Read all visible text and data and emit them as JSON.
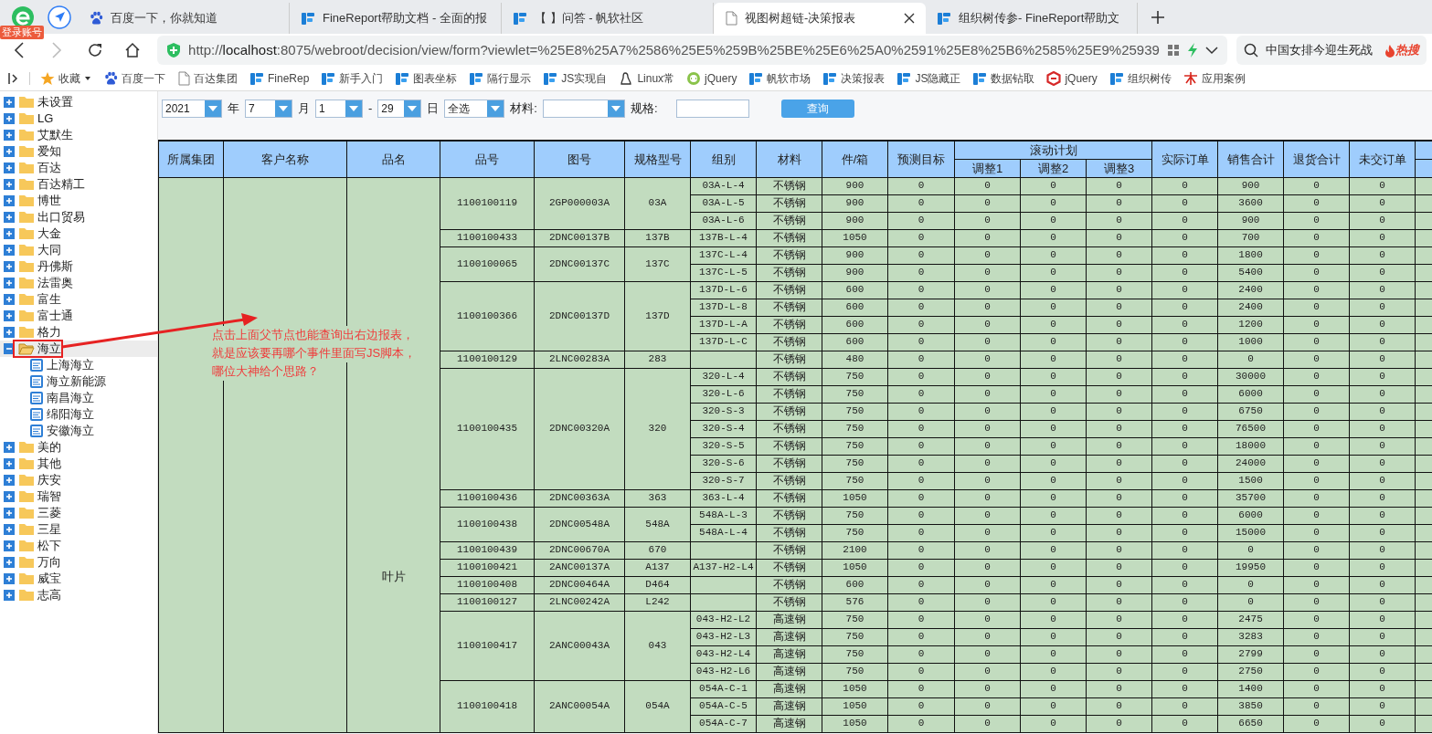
{
  "browser": {
    "login_badge": "登录账号",
    "tabs": [
      {
        "title": "百度一下，你就知道",
        "kind": "paw",
        "selected": false
      },
      {
        "title": "FineReport帮助文档 - 全面的报",
        "kind": "brand",
        "selected": false
      },
      {
        "title": "【        】问答 - 帆软社区",
        "kind": "brand",
        "selected": false
      },
      {
        "title": "视图树超链-决策报表",
        "kind": "page",
        "selected": true
      },
      {
        "title": "组织树传参- FineReport帮助文",
        "kind": "brand",
        "selected": false
      }
    ],
    "address": "http://**localhost**:8075/webroot/decision/view/form?viewlet=%25E8%25A7%2586%25E5%259B%25BE%25E6%25A0%2591%25E8%25B6%2585%25E9%25939",
    "search": {
      "text": "中国女排今迎生死战",
      "hot": "热搜"
    },
    "bookmarks": [
      {
        "title": "收藏",
        "kind": "star"
      },
      {
        "title": "百度一下",
        "kind": "paw"
      },
      {
        "title": "百达集团",
        "kind": "page"
      },
      {
        "title": "FineRep",
        "kind": "brand"
      },
      {
        "title": "新手入门",
        "kind": "brand"
      },
      {
        "title": "图表坐标",
        "kind": "brand"
      },
      {
        "title": "隔行显示",
        "kind": "brand"
      },
      {
        "title": "JS实现自",
        "kind": "brand"
      },
      {
        "title": "Linux常",
        "kind": "linux"
      },
      {
        "title": "jQuery",
        "kind": "jq"
      },
      {
        "title": "帆软市场",
        "kind": "brand"
      },
      {
        "title": "决策报表",
        "kind": "brand"
      },
      {
        "title": "JS隐藏正",
        "kind": "brand"
      },
      {
        "title": "数据钻取",
        "kind": "brand"
      },
      {
        "title": "jQuery",
        "kind": "jqred"
      },
      {
        "title": "组织树传",
        "kind": "brand"
      },
      {
        "title": "应用案例",
        "kind": "case"
      }
    ]
  },
  "tree": [
    {
      "label": "未设置",
      "kind": "folder",
      "expanded": false,
      "selected": false
    },
    {
      "label": "LG",
      "kind": "folder",
      "expanded": false,
      "selected": false
    },
    {
      "label": "艾默生",
      "kind": "folder",
      "expanded": false,
      "selected": false
    },
    {
      "label": "爱知",
      "kind": "folder",
      "expanded": false,
      "selected": false
    },
    {
      "label": "百达",
      "kind": "folder",
      "expanded": false,
      "selected": false
    },
    {
      "label": "百达精工",
      "kind": "folder",
      "expanded": false,
      "selected": false
    },
    {
      "label": "博世",
      "kind": "folder",
      "expanded": false,
      "selected": false
    },
    {
      "label": "出口贸易",
      "kind": "folder",
      "expanded": false,
      "selected": false
    },
    {
      "label": "大金",
      "kind": "folder",
      "expanded": false,
      "selected": false
    },
    {
      "label": "大同",
      "kind": "folder",
      "expanded": false,
      "selected": false
    },
    {
      "label": "丹佛斯",
      "kind": "folder",
      "expanded": false,
      "selected": false
    },
    {
      "label": "法雷奥",
      "kind": "folder",
      "expanded": false,
      "selected": false
    },
    {
      "label": "富生",
      "kind": "folder",
      "expanded": false,
      "selected": false
    },
    {
      "label": "富士通",
      "kind": "folder",
      "expanded": false,
      "selected": false
    },
    {
      "label": "格力",
      "kind": "folder",
      "expanded": false,
      "selected": false
    },
    {
      "label": "海立",
      "kind": "folder",
      "expanded": true,
      "selected": true,
      "children": [
        {
          "label": "上海海立",
          "kind": "report",
          "selected": false
        },
        {
          "label": "海立新能源",
          "kind": "report",
          "selected": false
        },
        {
          "label": "南昌海立",
          "kind": "report",
          "selected": false
        },
        {
          "label": "绵阳海立",
          "kind": "report",
          "selected": false
        },
        {
          "label": "安徽海立",
          "kind": "report",
          "selected": false
        }
      ]
    },
    {
      "label": "美的",
      "kind": "folder",
      "expanded": false,
      "selected": false
    },
    {
      "label": "其他",
      "kind": "folder",
      "expanded": false,
      "selected": false
    },
    {
      "label": "庆安",
      "kind": "folder",
      "expanded": false,
      "selected": false
    },
    {
      "label": "瑞智",
      "kind": "folder",
      "expanded": false,
      "selected": false
    },
    {
      "label": "三菱",
      "kind": "folder",
      "expanded": false,
      "selected": false
    },
    {
      "label": "三星",
      "kind": "folder",
      "expanded": false,
      "selected": false
    },
    {
      "label": "松下",
      "kind": "folder",
      "expanded": false,
      "selected": false
    },
    {
      "label": "万向",
      "kind": "folder",
      "expanded": false,
      "selected": false
    },
    {
      "label": "威宝",
      "kind": "folder",
      "expanded": false,
      "selected": false
    },
    {
      "label": "志高",
      "kind": "folder",
      "expanded": false,
      "selected": false
    }
  ],
  "filters": [
    {
      "kind": "combo",
      "value": "2021"
    },
    {
      "kind": "label",
      "text": "年"
    },
    {
      "kind": "combo",
      "value": "7"
    },
    {
      "kind": "label",
      "text": "月"
    },
    {
      "kind": "combo",
      "value": "1"
    },
    {
      "kind": "label",
      "text": "-"
    },
    {
      "kind": "combo",
      "value": "29"
    },
    {
      "kind": "label",
      "text": "日"
    },
    {
      "kind": "combo",
      "value": "全选"
    },
    {
      "kind": "label",
      "text": "材料:"
    },
    {
      "kind": "combo"
    },
    {
      "kind": "label",
      "text": "规格:"
    },
    {
      "kind": "input"
    },
    {
      "kind": "button",
      "text": "查询"
    }
  ],
  "annotation": {
    "lines": [
      "点击上面父节点也能查询出右边报表，",
      "就是应该要再哪个事件里面写JS脚本，",
      "哪位大神给个思路？"
    ]
  },
  "table": {
    "columns": [
      {
        "label": "所属集团"
      },
      {
        "label": "客户名称"
      },
      {
        "label": "品名"
      },
      {
        "label": "品号"
      },
      {
        "label": "图号"
      },
      {
        "label": "规格型号"
      },
      {
        "label": "组别"
      },
      {
        "label": "材料"
      },
      {
        "label": "件/箱"
      },
      {
        "label": "预测目标"
      },
      {
        "label": "滚动计划",
        "children": [
          "调整1",
          "调整2",
          "调整3"
        ]
      },
      {
        "label": "实际订单"
      },
      {
        "label": "销售合计"
      },
      {
        "label": "退货合计"
      },
      {
        "label": "未交订单"
      }
    ],
    "product_name": "叶片",
    "products": [
      {
        "part_no": "1100100119",
        "drawing_no": "2GP000003A",
        "spec": "03A",
        "items": [
          {
            "group": "03A-L-4",
            "material": "不锈钢",
            "per_box": "900",
            "values": [
              "0",
              "0",
              "0",
              "0",
              "0",
              "900",
              "0",
              "0"
            ]
          },
          {
            "group": "03A-L-5",
            "material": "不锈钢",
            "per_box": "900",
            "values": [
              "0",
              "0",
              "0",
              "0",
              "0",
              "3600",
              "0",
              "0"
            ]
          },
          {
            "group": "03A-L-6",
            "material": "不锈钢",
            "per_box": "900",
            "values": [
              "0",
              "0",
              "0",
              "0",
              "0",
              "900",
              "0",
              "0"
            ]
          }
        ]
      },
      {
        "part_no": "1100100433",
        "drawing_no": "2DNC00137B",
        "spec": "137B",
        "items": [
          {
            "group": "137B-L-4",
            "material": "不锈钢",
            "per_box": "1050",
            "values": [
              "0",
              "0",
              "0",
              "0",
              "0",
              "700",
              "0",
              "0"
            ]
          }
        ]
      },
      {
        "part_no": "1100100065",
        "drawing_no": "2DNC00137C",
        "spec": "137C",
        "items": [
          {
            "group": "137C-L-4",
            "material": "不锈钢",
            "per_box": "900",
            "values": [
              "0",
              "0",
              "0",
              "0",
              "0",
              "1800",
              "0",
              "0"
            ]
          },
          {
            "group": "137C-L-5",
            "material": "不锈钢",
            "per_box": "900",
            "values": [
              "0",
              "0",
              "0",
              "0",
              "0",
              "5400",
              "0",
              "0"
            ]
          }
        ]
      },
      {
        "part_no": "1100100366",
        "drawing_no": "2DNC00137D",
        "spec": "137D",
        "items": [
          {
            "group": "137D-L-6",
            "material": "不锈钢",
            "per_box": "600",
            "values": [
              "0",
              "0",
              "0",
              "0",
              "0",
              "2400",
              "0",
              "0"
            ]
          },
          {
            "group": "137D-L-8",
            "material": "不锈钢",
            "per_box": "600",
            "values": [
              "0",
              "0",
              "0",
              "0",
              "0",
              "2400",
              "0",
              "0"
            ]
          },
          {
            "group": "137D-L-A",
            "material": "不锈钢",
            "per_box": "600",
            "values": [
              "0",
              "0",
              "0",
              "0",
              "0",
              "1200",
              "0",
              "0"
            ]
          },
          {
            "group": "137D-L-C",
            "material": "不锈钢",
            "per_box": "600",
            "values": [
              "0",
              "0",
              "0",
              "0",
              "0",
              "1000",
              "0",
              "0"
            ]
          }
        ]
      },
      {
        "part_no": "1100100129",
        "drawing_no": "2LNC00283A",
        "spec": "283",
        "items": [
          {
            "material": "不锈钢",
            "per_box": "480",
            "values": [
              "0",
              "0",
              "0",
              "0",
              "0",
              "0",
              "0",
              "0"
            ]
          }
        ]
      },
      {
        "part_no": "1100100435",
        "drawing_no": "2DNC00320A",
        "spec": "320",
        "items": [
          {
            "group": "320-L-4",
            "material": "不锈钢",
            "per_box": "750",
            "values": [
              "0",
              "0",
              "0",
              "0",
              "0",
              "30000",
              "0",
              "0"
            ]
          },
          {
            "group": "320-L-6",
            "material": "不锈钢",
            "per_box": "750",
            "values": [
              "0",
              "0",
              "0",
              "0",
              "0",
              "6000",
              "0",
              "0"
            ]
          },
          {
            "group": "320-S-3",
            "material": "不锈钢",
            "per_box": "750",
            "values": [
              "0",
              "0",
              "0",
              "0",
              "0",
              "6750",
              "0",
              "0"
            ]
          },
          {
            "group": "320-S-4",
            "material": "不锈钢",
            "per_box": "750",
            "values": [
              "0",
              "0",
              "0",
              "0",
              "0",
              "76500",
              "0",
              "0"
            ]
          },
          {
            "group": "320-S-5",
            "material": "不锈钢",
            "per_box": "750",
            "values": [
              "0",
              "0",
              "0",
              "0",
              "0",
              "18000",
              "0",
              "0"
            ]
          },
          {
            "group": "320-S-6",
            "material": "不锈钢",
            "per_box": "750",
            "values": [
              "0",
              "0",
              "0",
              "0",
              "0",
              "24000",
              "0",
              "0"
            ]
          },
          {
            "group": "320-S-7",
            "material": "不锈钢",
            "per_box": "750",
            "values": [
              "0",
              "0",
              "0",
              "0",
              "0",
              "1500",
              "0",
              "0"
            ]
          }
        ]
      },
      {
        "part_no": "1100100436",
        "drawing_no": "2DNC00363A",
        "spec": "363",
        "items": [
          {
            "group": "363-L-4",
            "material": "不锈钢",
            "per_box": "1050",
            "values": [
              "0",
              "0",
              "0",
              "0",
              "0",
              "35700",
              "0",
              "0"
            ]
          }
        ]
      },
      {
        "part_no": "1100100438",
        "drawing_no": "2DNC00548A",
        "spec": "548A",
        "items": [
          {
            "group": "548A-L-3",
            "material": "不锈钢",
            "per_box": "750",
            "values": [
              "0",
              "0",
              "0",
              "0",
              "0",
              "6000",
              "0",
              "0"
            ]
          },
          {
            "group": "548A-L-4",
            "material": "不锈钢",
            "per_box": "750",
            "values": [
              "0",
              "0",
              "0",
              "0",
              "0",
              "15000",
              "0",
              "0"
            ]
          }
        ]
      },
      {
        "part_no": "1100100439",
        "drawing_no": "2DNC00670A",
        "spec": "670",
        "items": [
          {
            "material": "不锈钢",
            "per_box": "2100",
            "values": [
              "0",
              "0",
              "0",
              "0",
              "0",
              "0",
              "0",
              "0"
            ]
          }
        ]
      },
      {
        "part_no": "1100100421",
        "drawing_no": "2ANC00137A",
        "spec": "A137",
        "items": [
          {
            "group": "A137-H2-L4",
            "material": "不锈钢",
            "per_box": "1050",
            "values": [
              "0",
              "0",
              "0",
              "0",
              "0",
              "19950",
              "0",
              "0"
            ]
          }
        ]
      },
      {
        "part_no": "1100100408",
        "drawing_no": "2DNC00464A",
        "spec": "D464",
        "items": [
          {
            "material": "不锈钢",
            "per_box": "600",
            "values": [
              "0",
              "0",
              "0",
              "0",
              "0",
              "0",
              "0",
              "0"
            ]
          }
        ]
      },
      {
        "part_no": "1100100127",
        "drawing_no": "2LNC00242A",
        "spec": "L242",
        "items": [
          {
            "material": "不锈钢",
            "per_box": "576",
            "values": [
              "0",
              "0",
              "0",
              "0",
              "0",
              "0",
              "0",
              "0"
            ]
          }
        ]
      },
      {
        "part_no": "1100100417",
        "drawing_no": "2ANC00043A",
        "spec": "043",
        "items": [
          {
            "group": "043-H2-L2",
            "material": "高速钢",
            "per_box": "750",
            "values": [
              "0",
              "0",
              "0",
              "0",
              "0",
              "2475",
              "0",
              "0"
            ]
          },
          {
            "group": "043-H2-L3",
            "material": "高速钢",
            "per_box": "750",
            "values": [
              "0",
              "0",
              "0",
              "0",
              "0",
              "3283",
              "0",
              "0"
            ]
          },
          {
            "group": "043-H2-L4",
            "material": "高速钢",
            "per_box": "750",
            "values": [
              "0",
              "0",
              "0",
              "0",
              "0",
              "2799",
              "0",
              "0"
            ]
          },
          {
            "group": "043-H2-L6",
            "material": "高速钢",
            "per_box": "750",
            "values": [
              "0",
              "0",
              "0",
              "0",
              "0",
              "2750",
              "0",
              "0"
            ]
          }
        ]
      },
      {
        "part_no": "1100100418",
        "drawing_no": "2ANC00054A",
        "spec": "054A",
        "items": [
          {
            "group": "054A-C-1",
            "material": "高速钢",
            "per_box": "1050",
            "values": [
              "0",
              "0",
              "0",
              "0",
              "0",
              "1400",
              "0",
              "0"
            ]
          },
          {
            "group": "054A-C-5",
            "material": "高速钢",
            "per_box": "1050",
            "values": [
              "0",
              "0",
              "0",
              "0",
              "0",
              "3850",
              "0",
              "0"
            ]
          },
          {
            "group": "054A-C-7",
            "material": "高速钢",
            "per_box": "1050",
            "values": [
              "0",
              "0",
              "0",
              "0",
              "0",
              "6650",
              "0",
              "0"
            ]
          }
        ]
      }
    ]
  }
}
